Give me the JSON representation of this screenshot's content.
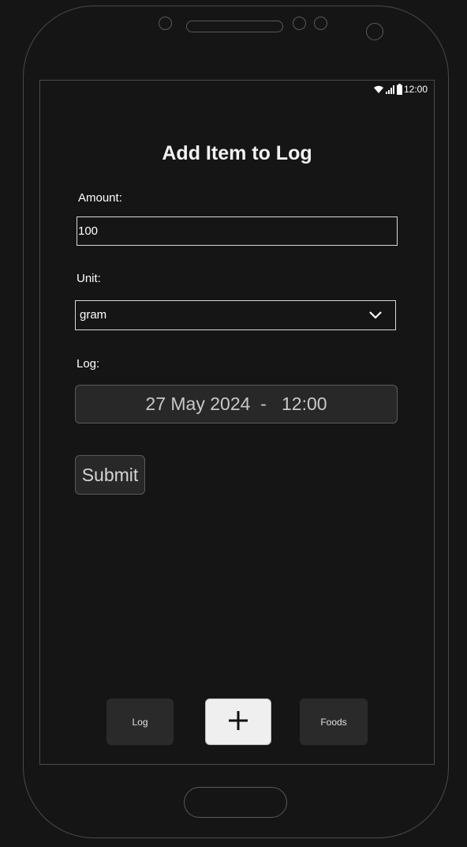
{
  "status_bar": {
    "time": "12:00",
    "icons": [
      "wifi-icon",
      "signal-icon",
      "battery-icon"
    ]
  },
  "page": {
    "title": "Add Item to Log"
  },
  "form": {
    "amount_label": "Amount:",
    "amount_value": "100",
    "unit_label": "Unit:",
    "unit_value": "gram",
    "log_label": "Log:",
    "log_datetime": "27 May 2024  -   12:00",
    "submit_label": "Submit"
  },
  "bottom_nav": {
    "log_label": "Log",
    "add_icon": "plus-icon",
    "foods_label": "Foods"
  },
  "colors": {
    "background": "#151515",
    "button_bg": "#282828",
    "active_button_bg": "#efefef",
    "text": "#ffffff"
  }
}
